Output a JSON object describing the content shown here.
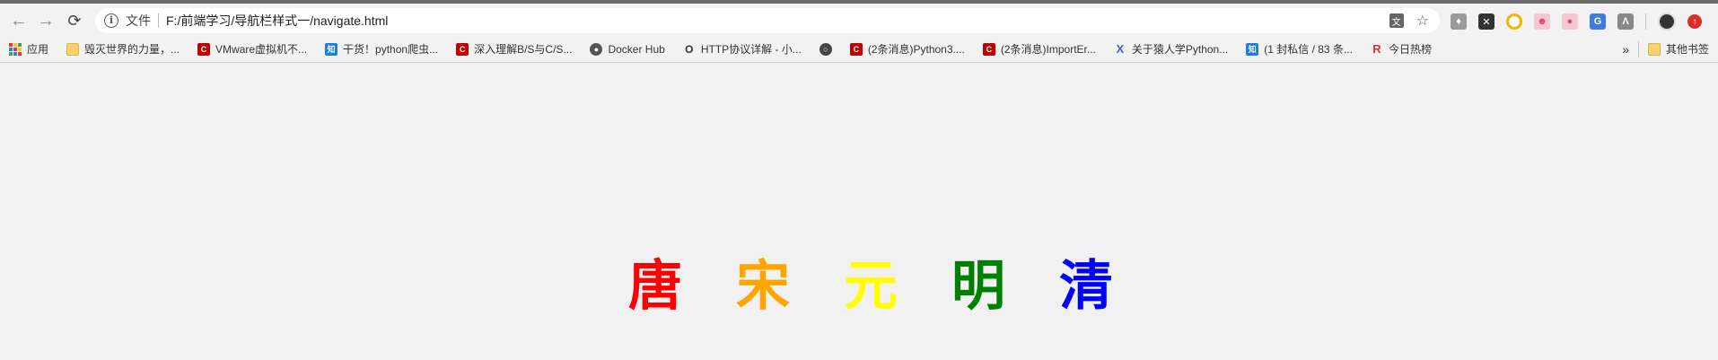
{
  "toolbar": {
    "back_icon": "back-arrow-icon",
    "forward_icon": "forward-arrow-icon",
    "reload_icon": "reload-icon",
    "scheme_label": "文件",
    "url": "F:/前端学习/导航栏样式一/navigate.html"
  },
  "bookmarks": [
    {
      "label": "应用",
      "icon": "apps-icon"
    },
    {
      "label": "毁灭世界的力量，...",
      "icon": "folder-icon"
    },
    {
      "label": "VMware虚拟机不...",
      "icon": "csdn-icon",
      "color": "#c00000"
    },
    {
      "label": "干货！python爬虫...",
      "icon": "zhihu-icon",
      "icon_text": "知",
      "color": "#1a7fd6"
    },
    {
      "label": "深入理解B/S与C/S...",
      "icon": "csdn-icon",
      "color": "#c00000"
    },
    {
      "label": "Docker Hub",
      "icon": "docker-icon",
      "color": "#555555"
    },
    {
      "label": "HTTP协议详解 - 小...",
      "icon": "http-icon",
      "color": "#333333"
    },
    {
      "label": "",
      "icon": "globe-icon",
      "color": "#444444"
    },
    {
      "label": "(2条消息)Python3....",
      "icon": "csdn-icon",
      "color": "#c00000"
    },
    {
      "label": "(2条消息)ImportEr...",
      "icon": "csdn-icon",
      "color": "#c00000"
    },
    {
      "label": "关于猿人学Python...",
      "icon": "x-icon",
      "icon_text": "X",
      "color": "#4a5bd6"
    },
    {
      "label": "(1 封私信 / 83 条...",
      "icon": "zhihu-icon",
      "icon_text": "知",
      "color": "#1a7fd6"
    },
    {
      "label": "今日热榜",
      "icon": "rebang-icon",
      "icon_text": "R",
      "color": "#e03030"
    }
  ],
  "bookmarks_overflow": "»",
  "other_bookmarks": "其他书签",
  "nav": {
    "items": [
      {
        "label": "唐",
        "color": "#ff0000"
      },
      {
        "label": "宋",
        "color": "#ffa500"
      },
      {
        "label": "元",
        "color": "#ffff00"
      },
      {
        "label": "明",
        "color": "#008000"
      },
      {
        "label": "清",
        "color": "#0000ff"
      }
    ]
  }
}
